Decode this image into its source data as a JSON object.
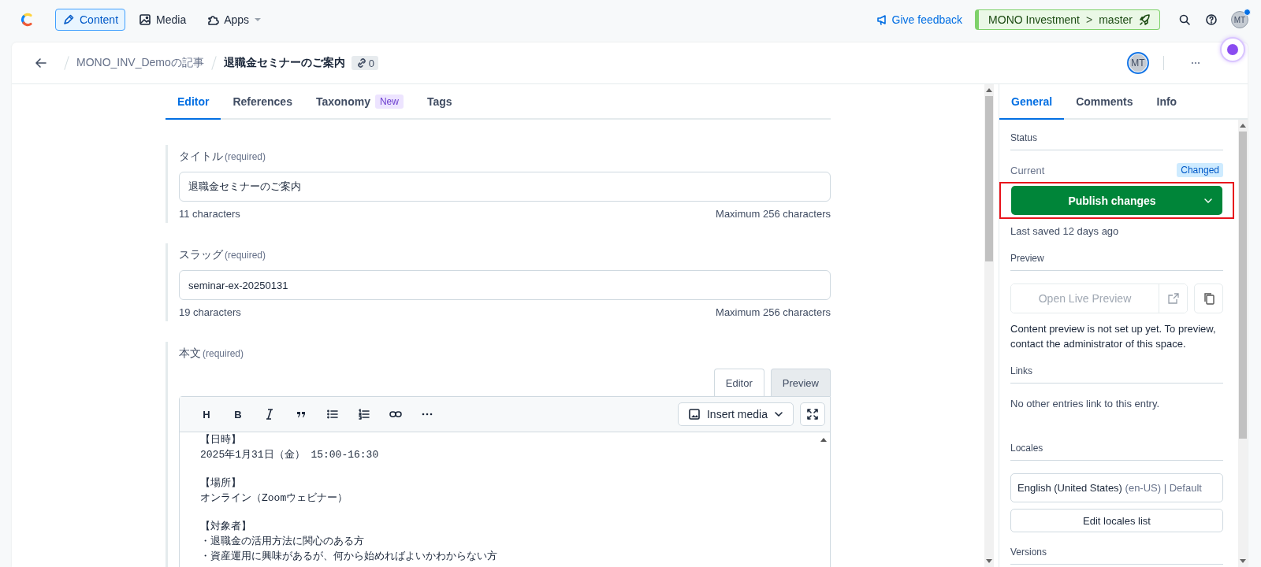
{
  "top_nav": {
    "items": [
      {
        "label": "Content",
        "kind": "pen",
        "selected": true,
        "dropdown": false
      },
      {
        "label": "Media",
        "kind": "image",
        "selected": false,
        "dropdown": false
      },
      {
        "label": "Apps",
        "kind": "puzzle",
        "selected": false,
        "dropdown": true
      }
    ],
    "feedback": "Give feedback",
    "environment": {
      "space": "MONO Investment",
      "separator": ">",
      "branch": "master"
    },
    "avatar": "MT",
    "avatar_notification": true
  },
  "header": {
    "breadcrumb": "MONO_INV_Demoの記事",
    "title": "退職金セミナーのご案内",
    "link_count": "0",
    "avatar": "MT"
  },
  "editor_tabs": [
    {
      "label": "Editor",
      "selected": true
    },
    {
      "label": "References",
      "selected": false
    },
    {
      "label": "Taxonomy",
      "badge": "New",
      "selected": false
    },
    {
      "label": "Tags",
      "selected": false
    }
  ],
  "fields": [
    {
      "kind": "text",
      "label": "タイトル",
      "hint": "(required)",
      "value": "退職金セミナーのご案内",
      "count": "11 characters",
      "max": "Maximum 256 characters"
    },
    {
      "kind": "text",
      "label": "スラッグ",
      "hint": "(required)",
      "value": "seminar-ex-20250131",
      "count": "19 characters",
      "max": "Maximum 256 characters"
    },
    {
      "kind": "markdown",
      "label": "本文",
      "hint": "(required)",
      "modes": [
        {
          "label": "Editor",
          "selected": true
        },
        {
          "label": "Preview",
          "selected": false
        }
      ],
      "toolbar": [
        {
          "kind": "heading",
          "label": "H"
        },
        {
          "kind": "bold",
          "label": "B"
        },
        {
          "kind": "italic"
        },
        {
          "kind": "quote"
        },
        {
          "kind": "bullets"
        },
        {
          "kind": "numbers"
        },
        {
          "kind": "link"
        },
        {
          "kind": "more"
        }
      ],
      "insert_media": "Insert media",
      "paragraphs": [
        [
          "【日時】",
          "2025年1月31日（金） 15:00-16:30"
        ],
        [
          "【場所】",
          "オンライン（Zoomウェビナー）"
        ],
        [
          "【対象者】",
          "・退職金の活用方法に関心のある方",
          "・資産運用に興味があるが、何から始めればよいかわからない方"
        ]
      ]
    }
  ],
  "sidebar": {
    "tabs": [
      {
        "label": "General",
        "selected": true
      },
      {
        "label": "Comments",
        "selected": false
      },
      {
        "label": "Info",
        "selected": false
      }
    ],
    "status": {
      "heading": "Status",
      "current": "Current",
      "badge": "Changed",
      "publish": "Publish changes",
      "highlighted": true,
      "last_saved": "Last saved 12 days ago"
    },
    "preview": {
      "heading": "Preview",
      "button": "Open Live Preview",
      "disabled": true,
      "note": "Content preview is not set up yet. To preview, contact the administrator of this space."
    },
    "links": {
      "heading": "Links",
      "text": "No other entries link to this entry."
    },
    "locales": {
      "heading": "Locales",
      "locale": "English (United States)",
      "code": "(en-US) | Default",
      "button": "Edit locales list"
    },
    "versions": {
      "heading": "Versions"
    }
  }
}
